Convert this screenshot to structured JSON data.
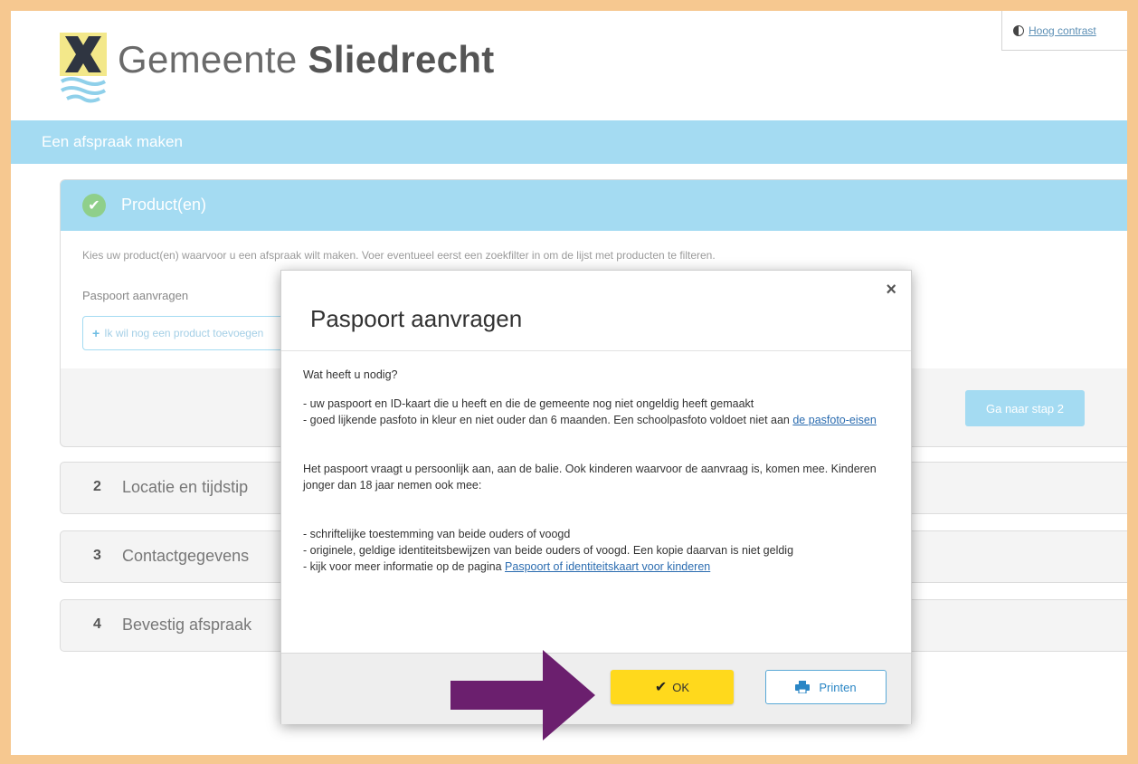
{
  "header": {
    "brand_prefix": "Gemeente ",
    "brand_name": "Sliedrecht",
    "contrast_label": "Hoog contrast"
  },
  "page_title": "Een afspraak maken",
  "step1": {
    "title": "Product(en)",
    "intro": "Kies uw product(en) waarvoor u een afspraak wilt maken. Voer eventueel eerst een zoekfilter in om de lijst met producten te filteren.",
    "product_label": "Paspoort aanvragen",
    "add_product": "Ik wil nog een product toevoegen",
    "next_button": "Ga naar stap 2"
  },
  "steps": [
    {
      "num": "2",
      "label": "Locatie en tijdstip"
    },
    {
      "num": "3",
      "label": "Contactgegevens"
    },
    {
      "num": "4",
      "label": "Bevestig afspraak"
    }
  ],
  "modal": {
    "title": "Paspoort aanvragen",
    "close": "×",
    "question": "Wat heeft u nodig?",
    "req1": "- uw paspoort en ID-kaart die u heeft en die de gemeente nog niet ongeldig heeft gemaakt",
    "req2": "- goed lijkende pasfoto in kleur en niet ouder dan 6 maanden. Een schoolpasfoto voldoet niet aan ",
    "req2_link": "de pasfoto-eisen",
    "personal": "Het paspoort vraagt u persoonlijk aan, aan de balie. Ook kinderen waarvoor de aanvraag is, komen mee. Kinderen jonger dan 18 jaar nemen ook mee:",
    "kid1": "- schriftelijke toestemming van beide ouders of voogd",
    "kid2": "- originele, geldige identiteitsbewijzen van beide ouders of voogd. Een kopie daarvan is niet geldig",
    "kid3": "- kijk voor meer informatie op de pagina ",
    "kid3_link": "Paspoort of identiteitskaart voor kinderen",
    "ok_label": "OK",
    "print_label": "Printen"
  },
  "colors": {
    "accent_blue": "#a4dbf2",
    "ok_yellow": "#ffd91c",
    "arrow_purple": "#6b1f6e",
    "frame_orange": "#f6c890"
  }
}
